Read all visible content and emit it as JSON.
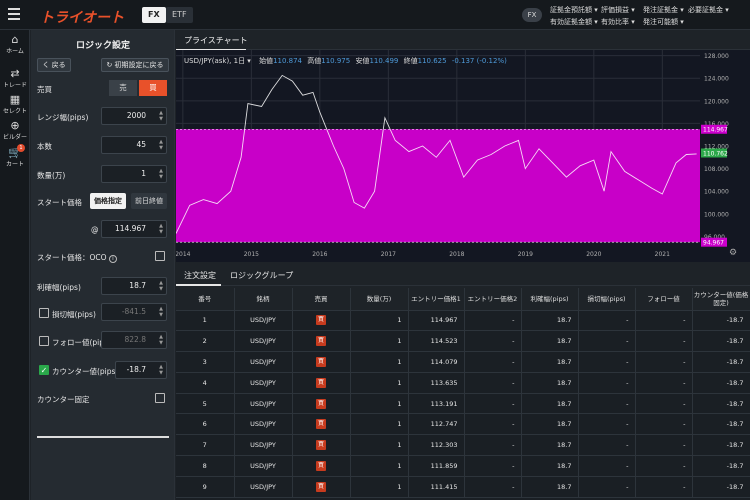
{
  "app": {
    "logo": "トライオート",
    "segments": {
      "fx": "FX",
      "etf": "ETF"
    },
    "account_badge": "FX"
  },
  "account": [
    "証拠金預託額 ▾",
    "評価損益 ▾",
    "発注証拠金 ▾",
    "必要証拠金 ▾",
    "有効証拠金額 ▾",
    "有効比率 ▾",
    "発注可能額 ▾"
  ],
  "nav": [
    {
      "label": "ホーム",
      "icon": "home-icon",
      "glyph": "⌂"
    },
    {
      "label": "トレード",
      "icon": "trade-icon",
      "glyph": "⇄"
    },
    {
      "label": "セレクト",
      "icon": "select-icon",
      "glyph": "▦"
    },
    {
      "label": "ビルダー",
      "icon": "builder-icon",
      "glyph": "⊕"
    },
    {
      "label": "カート",
      "icon": "cart-icon",
      "glyph": "🛒",
      "badge": "1"
    }
  ],
  "panel": {
    "title": "ロジック設定",
    "back": "く 戻る",
    "reset": "↻ 初期設定に戻る",
    "side_label": "売買",
    "side_sell": "売",
    "side_buy": "買",
    "range_label": "レンジ幅(pips)",
    "range_value": "2000",
    "count_label": "本数",
    "count_value": "45",
    "qty_label": "数量(万)",
    "qty_value": "1",
    "start_label": "スタート価格",
    "start_specify": "価格指定",
    "start_prev": "前日終値",
    "at": "@",
    "start_value": "114.967",
    "oco_label": "スタート価格：OCO",
    "tp_label": "利確幅(pips)",
    "tp_value": "18.7",
    "sl_label": "損切幅(pips)",
    "sl_value": "-841.5",
    "follow_label": "フォロー値(pips)",
    "follow_value": "822.8",
    "counter_label": "カウンター値(pips)",
    "counter_value": "-18.7",
    "counter_fixed_label": "カウンター固定"
  },
  "chart": {
    "tab": "プライスチャート",
    "symbol": "USD/JPY(ask), 1日 ▾",
    "ohlc": [
      {
        "label": "始値",
        "value": "110.874"
      },
      {
        "label": "高値",
        "value": "110.975"
      },
      {
        "label": "安値",
        "value": "110.499"
      },
      {
        "label": "終値",
        "value": "110.625"
      }
    ],
    "change": "-0.137 (-0.12%)",
    "colors": {
      "band": "#c800c8",
      "line": "#ffffff",
      "current_tag": "#2ca84a",
      "top_tag": "#cc00cc"
    }
  },
  "chart_data": {
    "type": "line",
    "x_labels": [
      "2014",
      "2015",
      "2016",
      "2017",
      "2018",
      "2019",
      "2020",
      "2021"
    ],
    "y_ticks": [
      "128.000",
      "124.000",
      "120.000",
      "116.000",
      "112.000",
      "108.000",
      "104.000",
      "100.000",
      "96.000"
    ],
    "ylim": [
      95,
      129
    ],
    "range_top": "114.967",
    "range_bottom": "94.967",
    "current_price": "110.762",
    "series_points": [
      [
        2013.9,
        96.5
      ],
      [
        2014.1,
        101.5
      ],
      [
        2014.3,
        102.5
      ],
      [
        2014.5,
        101.8
      ],
      [
        2014.7,
        104.0
      ],
      [
        2014.85,
        110.0
      ],
      [
        2014.95,
        119.5
      ],
      [
        2015.15,
        119.0
      ],
      [
        2015.3,
        122.0
      ],
      [
        2015.45,
        124.5
      ],
      [
        2015.6,
        123.5
      ],
      [
        2015.75,
        121.0
      ],
      [
        2015.9,
        121.5
      ],
      [
        2016.0,
        118.0
      ],
      [
        2016.2,
        112.0
      ],
      [
        2016.35,
        108.0
      ],
      [
        2016.5,
        102.0
      ],
      [
        2016.65,
        101.0
      ],
      [
        2016.8,
        104.0
      ],
      [
        2016.95,
        117.0
      ],
      [
        2017.1,
        113.0
      ],
      [
        2017.3,
        111.0
      ],
      [
        2017.5,
        112.0
      ],
      [
        2017.7,
        110.0
      ],
      [
        2017.9,
        113.0
      ],
      [
        2018.1,
        106.5
      ],
      [
        2018.3,
        109.5
      ],
      [
        2018.5,
        110.5
      ],
      [
        2018.7,
        112.0
      ],
      [
        2018.9,
        113.0
      ],
      [
        2019.0,
        108.0
      ],
      [
        2019.2,
        111.5
      ],
      [
        2019.4,
        109.0
      ],
      [
        2019.6,
        106.5
      ],
      [
        2019.8,
        108.5
      ],
      [
        2020.0,
        109.5
      ],
      [
        2020.15,
        104.0
      ],
      [
        2020.25,
        111.0
      ],
      [
        2020.45,
        107.5
      ],
      [
        2020.65,
        106.0
      ],
      [
        2020.85,
        104.5
      ],
      [
        2021.0,
        103.5
      ],
      [
        2021.2,
        109.0
      ],
      [
        2021.35,
        110.5
      ],
      [
        2021.5,
        110.6
      ]
    ]
  },
  "table": {
    "tabs": [
      "注文設定",
      "ロジックグループ"
    ],
    "headers": [
      "番号",
      "銘柄",
      "売買",
      "数量(万)",
      "エントリー価格1",
      "エントリー価格2",
      "利確幅(pips)",
      "損切幅(pips)",
      "フォロー値",
      "カウンター値(価格固定)"
    ],
    "rows": [
      [
        "1",
        "USD/JPY",
        "買",
        "1",
        "114.967",
        "-",
        "18.7",
        "-",
        "-",
        "-18.7"
      ],
      [
        "2",
        "USD/JPY",
        "買",
        "1",
        "114.523",
        "-",
        "18.7",
        "-",
        "-",
        "-18.7"
      ],
      [
        "3",
        "USD/JPY",
        "買",
        "1",
        "114.079",
        "-",
        "18.7",
        "-",
        "-",
        "-18.7"
      ],
      [
        "4",
        "USD/JPY",
        "買",
        "1",
        "113.635",
        "-",
        "18.7",
        "-",
        "-",
        "-18.7"
      ],
      [
        "5",
        "USD/JPY",
        "買",
        "1",
        "113.191",
        "-",
        "18.7",
        "-",
        "-",
        "-18.7"
      ],
      [
        "6",
        "USD/JPY",
        "買",
        "1",
        "112.747",
        "-",
        "18.7",
        "-",
        "-",
        "-18.7"
      ],
      [
        "7",
        "USD/JPY",
        "買",
        "1",
        "112.303",
        "-",
        "18.7",
        "-",
        "-",
        "-18.7"
      ],
      [
        "8",
        "USD/JPY",
        "買",
        "1",
        "111.859",
        "-",
        "18.7",
        "-",
        "-",
        "-18.7"
      ],
      [
        "9",
        "USD/JPY",
        "買",
        "1",
        "111.415",
        "-",
        "18.7",
        "-",
        "-",
        "-18.7"
      ]
    ]
  }
}
